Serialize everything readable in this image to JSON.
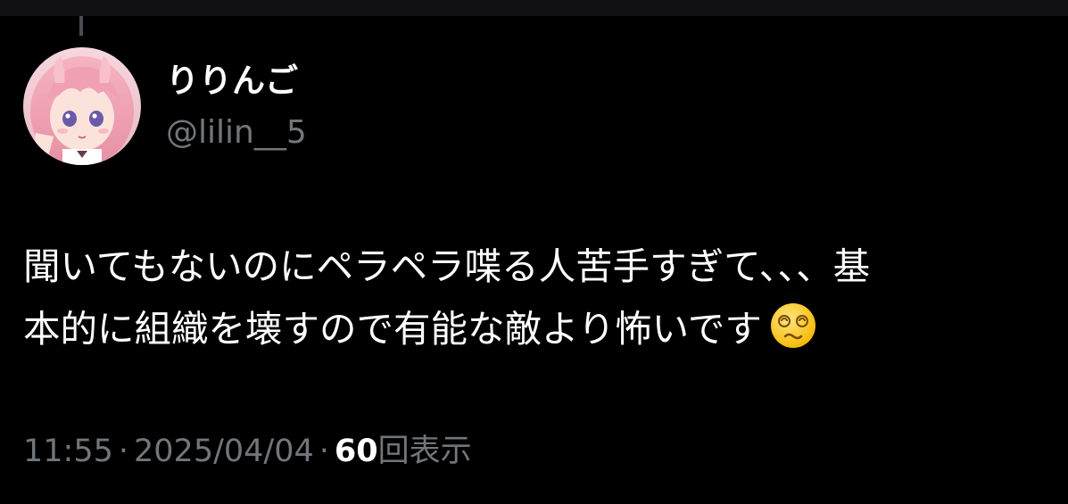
{
  "tweet": {
    "author": {
      "display_name": "りりんご",
      "handle": "@lilin__5"
    },
    "text_lines": [
      "聞いてもないのにペラペラ喋る人苦手すぎて、、、基",
      "本的に組織を壊すので有能な敵より怖いです"
    ],
    "emoji": "dizzy-face-emoji",
    "meta": {
      "time": "11:55",
      "separator": "·",
      "date": "2025/04/04",
      "views_count": "60",
      "views_label": "回表示"
    }
  },
  "colors": {
    "background": "#000000",
    "primary_text": "#ffffff",
    "secondary_text": "#71767b",
    "avatar_hair": "#f3a7b5"
  }
}
